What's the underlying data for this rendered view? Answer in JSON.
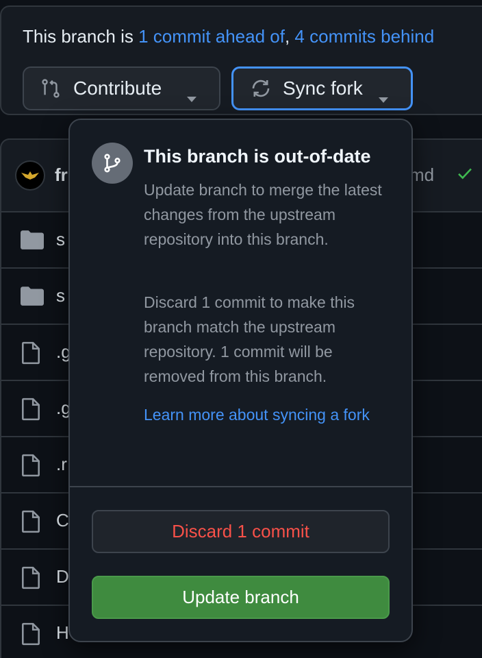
{
  "status": {
    "prefix": "This branch is ",
    "ahead_link": "1 commit ahead of",
    "separator": ", ",
    "behind_link": "4 commits behind"
  },
  "buttons": {
    "contribute": "Contribute",
    "sync_fork": "Sync fork"
  },
  "file_header": {
    "user_fragment": "fr",
    "file_fragment": "md"
  },
  "files": [
    {
      "type": "folder",
      "name_fragment": "s"
    },
    {
      "type": "folder",
      "name_fragment": "s"
    },
    {
      "type": "file",
      "name_fragment": ".g"
    },
    {
      "type": "file",
      "name_fragment": ".g"
    },
    {
      "type": "file",
      "name_fragment": ".r"
    },
    {
      "type": "file",
      "name_fragment": "C"
    },
    {
      "type": "file",
      "name_fragment": "D"
    },
    {
      "type": "file",
      "name_fragment": "H"
    }
  ],
  "popover": {
    "title": "This branch is out-of-date",
    "paragraph1": "Update branch to merge the latest changes from the upstream repository into this branch.",
    "paragraph2": "Discard 1 commit to make this branch match the upstream repository. 1 commit will be removed from this branch.",
    "learn_more": "Learn more about syncing a fork",
    "discard_button": "Discard 1 commit",
    "update_button": "Update branch"
  },
  "colors": {
    "background": "#0d1117",
    "link": "#4493f8",
    "danger": "#f85149",
    "success_button": "#3f8b3f"
  },
  "icons": [
    "git-compare-icon",
    "sync-icon",
    "caret-down-icon",
    "git-branch-icon",
    "folder-icon",
    "file-icon",
    "check-icon",
    "avatar"
  ]
}
